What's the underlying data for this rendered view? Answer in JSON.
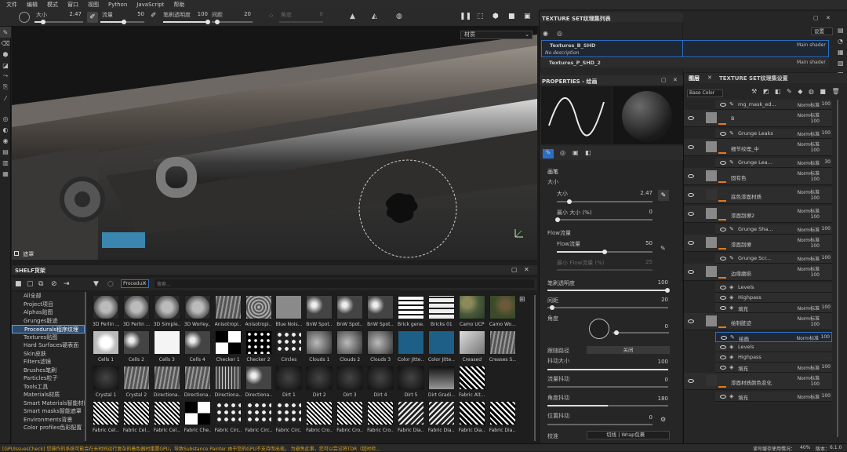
{
  "menu": [
    "文件",
    "编辑",
    "模式",
    "窗口",
    "视图",
    "Python",
    "JavaScript",
    "帮助"
  ],
  "tool_options": {
    "size_label": "大小",
    "size_value": "2.47",
    "flow_label": "流量",
    "flow_value": "50",
    "opacity_label": "笔刷透明度",
    "opacity_value": "100",
    "spacing_label": "间距",
    "spacing_value": "20",
    "angle_label": "角度",
    "angle_value": "0"
  },
  "viewport": {
    "material_dropdown": "材质",
    "bottom_label": "遮罩"
  },
  "shelf": {
    "title": "SHELF货架",
    "filter_chip": "Procedu...",
    "search_placeholder": "搜索...",
    "categories": [
      "All全部",
      "Project项目",
      "Alphas贴图",
      "Grunges脏迹",
      "Procedurals程序纹理",
      "Textures贴图",
      "Hard Surfaces硬表面",
      "Skin皮肤",
      "Filters滤镜",
      "Brushes笔刷",
      "Particles粒子",
      "Tools工具",
      "Materials材质",
      "Smart Materials智能材质",
      "Smart masks智能遮罩",
      "Environments背景",
      "Color profiles色彩配置"
    ],
    "selected_category": 4,
    "items": [
      {
        "name": "3D Perlin ...",
        "tex": "hex"
      },
      {
        "name": "3D Perlin ...",
        "tex": "hex"
      },
      {
        "name": "3D Simple...",
        "tex": "hex"
      },
      {
        "name": "3D Worley...",
        "tex": "hex"
      },
      {
        "name": "Anisotropi...",
        "tex": "streak"
      },
      {
        "name": "Anisotropi...",
        "tex": "swirl"
      },
      {
        "name": "Blue Nois...",
        "tex": "gray"
      },
      {
        "name": "BnW Spot...",
        "tex": "noise"
      },
      {
        "name": "BnW Spot...",
        "tex": "noise"
      },
      {
        "name": "BnW Spot...",
        "tex": "noise"
      },
      {
        "name": "Brick gene...",
        "tex": "brick"
      },
      {
        "name": "Bricks 01",
        "tex": "bricks"
      },
      {
        "name": "Camo UCP",
        "tex": "camo"
      },
      {
        "name": "Camo Wo...",
        "tex": "camo2"
      },
      {
        "name": "Cells 1",
        "tex": "cells"
      },
      {
        "name": "Cells 2",
        "tex": "noise"
      },
      {
        "name": "Cells 3",
        "tex": "white"
      },
      {
        "name": "Cells 4",
        "tex": "noise"
      },
      {
        "name": "Checker 1",
        "tex": "checker"
      },
      {
        "name": "Checker 2",
        "tex": "dots"
      },
      {
        "name": "Circles",
        "tex": "circles"
      },
      {
        "name": "Clouds 1",
        "tex": "clouds"
      },
      {
        "name": "Clouds 2",
        "tex": "clouds"
      },
      {
        "name": "Clouds 3",
        "tex": "clouds"
      },
      {
        "name": "Color Jitte...",
        "tex": "blue"
      },
      {
        "name": "Color Jitte...",
        "tex": "blue"
      },
      {
        "name": "Creased",
        "tex": "creased"
      },
      {
        "name": "Creases S...",
        "tex": "streak"
      },
      {
        "name": "Crystal 1",
        "tex": "dark"
      },
      {
        "name": "Crystal 2",
        "tex": "streak"
      },
      {
        "name": "Directiona...",
        "tex": "streak"
      },
      {
        "name": "Directiona...",
        "tex": "streak"
      },
      {
        "name": "Directiona...",
        "tex": "lines"
      },
      {
        "name": "Directiona...",
        "tex": "noise"
      },
      {
        "name": "Dirt 1",
        "tex": "dark"
      },
      {
        "name": "Dirt 2",
        "tex": "dark"
      },
      {
        "name": "Dirt 3",
        "tex": "dark"
      },
      {
        "name": "Dirt 4",
        "tex": "dark"
      },
      {
        "name": "Dirt 5",
        "tex": "dark"
      },
      {
        "name": "Dirt Gradi...",
        "tex": "gradient"
      },
      {
        "name": "Fabric Alt...",
        "tex": "zigzag"
      },
      {
        "name": "",
        "tex": "blank"
      },
      {
        "name": "Fabric Cel...",
        "tex": "weave"
      },
      {
        "name": "Fabric Cel...",
        "tex": "weave"
      },
      {
        "name": "Fabric Cel...",
        "tex": "weave"
      },
      {
        "name": "Fabric Che...",
        "tex": "checker"
      },
      {
        "name": "Fabric Circ...",
        "tex": "circles"
      },
      {
        "name": "Fabric Circ...",
        "tex": "circles"
      },
      {
        "name": "Fabric Circ...",
        "tex": "circles"
      },
      {
        "name": "Fabric Cro...",
        "tex": "weave"
      },
      {
        "name": "Fabric Cro...",
        "tex": "weave"
      },
      {
        "name": "Fabric Cro...",
        "tex": "weave"
      },
      {
        "name": "Fabric Dia...",
        "tex": "diag"
      },
      {
        "name": "Fabric Dia...",
        "tex": "diag"
      },
      {
        "name": "Fabric Dia...",
        "tex": "zigzag"
      },
      {
        "name": "Fabric Dia...",
        "tex": "zigzag"
      }
    ]
  },
  "texture_sets": {
    "title": "TEXTURE SET纹理集列表",
    "settings_btn": "设置",
    "items": [
      {
        "name": "Textures_B_SHD",
        "shader": "Main shader",
        "desc": "No description"
      },
      {
        "name": "Textures_P_SHD_2",
        "shader": "Main shader"
      }
    ]
  },
  "properties": {
    "title": "PROPERTIES - 绘画",
    "section": "画笔",
    "size_label": "大小",
    "size_sub": "大小",
    "size_value": "2.47",
    "min_size_label": "最小 大小 (%)",
    "min_size_value": "0",
    "flow_label": "Flow流量",
    "flow_sub": "Flow流量",
    "flow_value": "50",
    "min_flow_label": "最小 Flow流量 (%)",
    "min_flow_value": "25",
    "opacity_label": "笔刷透明度",
    "opacity_value": "100",
    "spacing_label": "间距",
    "spacing_value": "20",
    "angle_label": "角度",
    "angle_value": "0",
    "follow_path_label": "跟随路径",
    "follow_path_value": "关闭",
    "size_jitter_label": "抖动大小",
    "size_jitter_value": "100",
    "flow_jitter_label": "流量抖动",
    "flow_jitter_value": "0",
    "angle_jitter_label": "角度抖动",
    "angle_jitter_value": "180",
    "pos_jitter_label": "位置抖动",
    "pos_jitter_value": "0",
    "alignment_label": "校准",
    "alignment_value": "切线 | Wrap包裹"
  },
  "layers_panel": {
    "tab1": "图层",
    "tab2": "TEXTURE SET纹理集设置",
    "channel": "Base Color",
    "rows": [
      {
        "name": "mg_mask_ed...",
        "blend": "Norm标准",
        "opacity": "100",
        "type": "sub"
      },
      {
        "name": "B",
        "blend": "Norm标准",
        "opacity": "100",
        "type": "layer",
        "blend2": "Norm标准"
      },
      {
        "name": "Grunge Leaks",
        "blend": "Norm标准",
        "opacity": "100",
        "type": "sub"
      },
      {
        "name": "细节纹理_中",
        "blend": "Norm标准",
        "opacity": "100",
        "type": "layer"
      },
      {
        "name": "Grunge Lea...",
        "blend": "Norm标准",
        "opacity": "30",
        "type": "sub"
      },
      {
        "name": "固有色",
        "blend": "Norm标准",
        "opacity": "100",
        "type": "layer"
      },
      {
        "name": "底色漆面材质",
        "blend": "Norm标准",
        "opacity": "100",
        "type": "folder"
      },
      {
        "name": "漆面刮擦2",
        "blend": "Norm标准",
        "opacity": "100",
        "type": "layer"
      },
      {
        "name": "Grunge Sha...",
        "blend": "Norm标准",
        "opacity": "100",
        "type": "sub"
      },
      {
        "name": "漆面刮擦",
        "blend": "Norm标准",
        "opacity": "100",
        "type": "layer"
      },
      {
        "name": "Grunge Scr...",
        "blend": "Norm标准",
        "opacity": "100",
        "type": "sub"
      },
      {
        "name": "边缘磨损",
        "blend": "Norm标准",
        "opacity": "100",
        "type": "layer"
      },
      {
        "name": "Levels",
        "type": "effect"
      },
      {
        "name": "Highpass",
        "type": "effect"
      },
      {
        "name": "填充",
        "blend": "Norm标准",
        "opacity": "100",
        "type": "effect"
      },
      {
        "name": "绘制脏迹",
        "blend": "Norm标准",
        "opacity": "100",
        "type": "layer"
      },
      {
        "name": "绘画",
        "blend": "Norm标准",
        "opacity": "100",
        "type": "sub_sel"
      },
      {
        "name": "Levels",
        "type": "effect"
      },
      {
        "name": "Highpass",
        "type": "effect"
      },
      {
        "name": "填充",
        "blend": "Norm标准",
        "opacity": "100",
        "type": "effect"
      },
      {
        "name": "漆面材质颜色变化",
        "blend": "Norm标准",
        "opacity": "100",
        "type": "folder"
      },
      {
        "name": "填充",
        "blend": "Norm标准",
        "opacity": "100",
        "type": "effect"
      }
    ]
  },
  "status": {
    "left": "[GPUIssuesCheck] 您操作的系统可能会在长时间运行复杂的着色器时重置GPU，导致Substance Painter 由于您的GPU不支持而出现。 为避免此事，您可以尝试将TDR（超时检...",
    "right": "读写缓存使用情况：",
    "percent": "40%",
    "version": "版本：",
    "version_num": "6.1.0"
  },
  "colors": {
    "accent": "#2e6ec0",
    "orange": "#e07a1f",
    "selected": "#2e4a6b"
  }
}
